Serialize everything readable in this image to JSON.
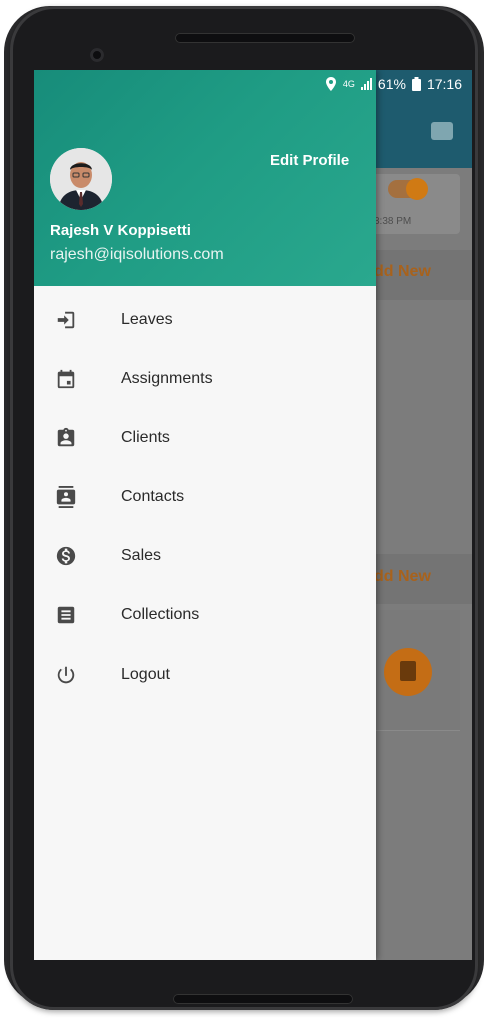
{
  "status_bar": {
    "network": "4G",
    "battery": "61%",
    "time": "17:16"
  },
  "drawer": {
    "edit_profile_label": "Edit Profile",
    "user_name": "Rajesh V Koppisetti",
    "user_email": "rajesh@iqisolutions.com",
    "menu": [
      {
        "label": "Leaves",
        "icon": "login-icon"
      },
      {
        "label": "Assignments",
        "icon": "calendar-icon"
      },
      {
        "label": "Clients",
        "icon": "badge-icon"
      },
      {
        "label": "Contacts",
        "icon": "contacts-icon"
      },
      {
        "label": "Sales",
        "icon": "dollar-icon"
      },
      {
        "label": "Collections",
        "icon": "list-icon"
      },
      {
        "label": "Logout",
        "icon": "power-icon"
      }
    ]
  },
  "background": {
    "time_text": "3:38 PM",
    "add_new_1": "dd New",
    "add_new_2": "dd New"
  },
  "colors": {
    "header_teal": "#1f9c84",
    "accent_orange": "#d07a14",
    "appbar": "#1e5b6e"
  }
}
